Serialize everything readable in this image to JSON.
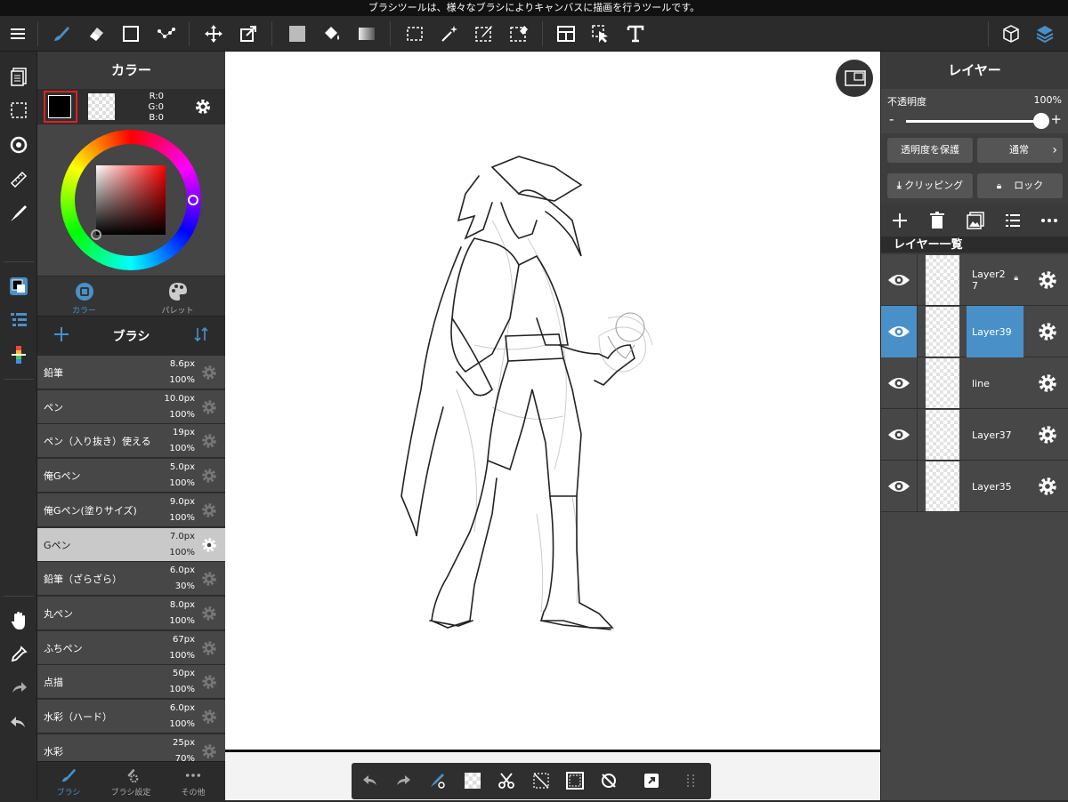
{
  "tip": "ブラシツールは、様々なブラシによりキャンバスに描画を行うツールです。",
  "colors": {
    "accent": "#4a90c8",
    "bg": "#2b2b2b"
  },
  "toolbar": {
    "icons": [
      "menu-icon",
      "brush-icon",
      "eraser-icon",
      "shape-icon",
      "dot-icon",
      "move-icon",
      "transform-icon",
      "fill-color-icon",
      "bucket-icon",
      "gradient-icon",
      "select-rect-icon",
      "magic-wand-icon",
      "select-pen-icon",
      "select-eraser-icon",
      "layout-icon",
      "select-move-icon",
      "text-icon",
      "3d-icon",
      "layers-icon"
    ]
  },
  "color_panel": {
    "title": "カラー",
    "rgb": {
      "r": "R:0",
      "g": "G:0",
      "b": "B:0"
    },
    "tabs": [
      "カラー",
      "パレット"
    ]
  },
  "brush_panel": {
    "title": "ブラシ",
    "brushes": [
      {
        "name": "鉛筆",
        "size": "8.6px",
        "opacity": "100%"
      },
      {
        "name": "ペン",
        "size": "10.0px",
        "opacity": "100%"
      },
      {
        "name": "ペン（入り抜き）使える",
        "size": "19px",
        "opacity": "100%"
      },
      {
        "name": "俺Gペン",
        "size": "5.0px",
        "opacity": "100%"
      },
      {
        "name": "俺Gペン(塗りサイズ)",
        "size": "9.0px",
        "opacity": "100%"
      },
      {
        "name": "Gペン",
        "size": "7.0px",
        "opacity": "100%",
        "selected": true
      },
      {
        "name": "鉛筆（ざらざら）",
        "size": "6.0px",
        "opacity": "30%"
      },
      {
        "name": "丸ペン",
        "size": "8.0px",
        "opacity": "100%"
      },
      {
        "name": "ふちペン",
        "size": "67px",
        "opacity": "100%"
      },
      {
        "name": "点描",
        "size": "50px",
        "opacity": "100%"
      },
      {
        "name": "水彩（ハード）",
        "size": "6.0px",
        "opacity": "100%"
      },
      {
        "name": "水彩",
        "size": "25px",
        "opacity": "70%"
      }
    ],
    "tabs": [
      "ブラシ",
      "ブラシ設定",
      "その他"
    ]
  },
  "layer_panel": {
    "title": "レイヤー",
    "opacity_label": "不透明度",
    "opacity_value": "100%",
    "opacity_fraction": 1.0,
    "minus": "-",
    "plus": "+",
    "protect_alpha": "透明度を保護",
    "blend_mode": "通常",
    "clipping": "クリッピング",
    "lock": "ロック",
    "list_title": "レイヤー一覧",
    "layers": [
      {
        "name": "Layer2\n7",
        "locked": true
      },
      {
        "name": "Layer39",
        "selected": true
      },
      {
        "name": "line"
      },
      {
        "name": "Layer37"
      },
      {
        "name": "Layer35"
      }
    ]
  }
}
